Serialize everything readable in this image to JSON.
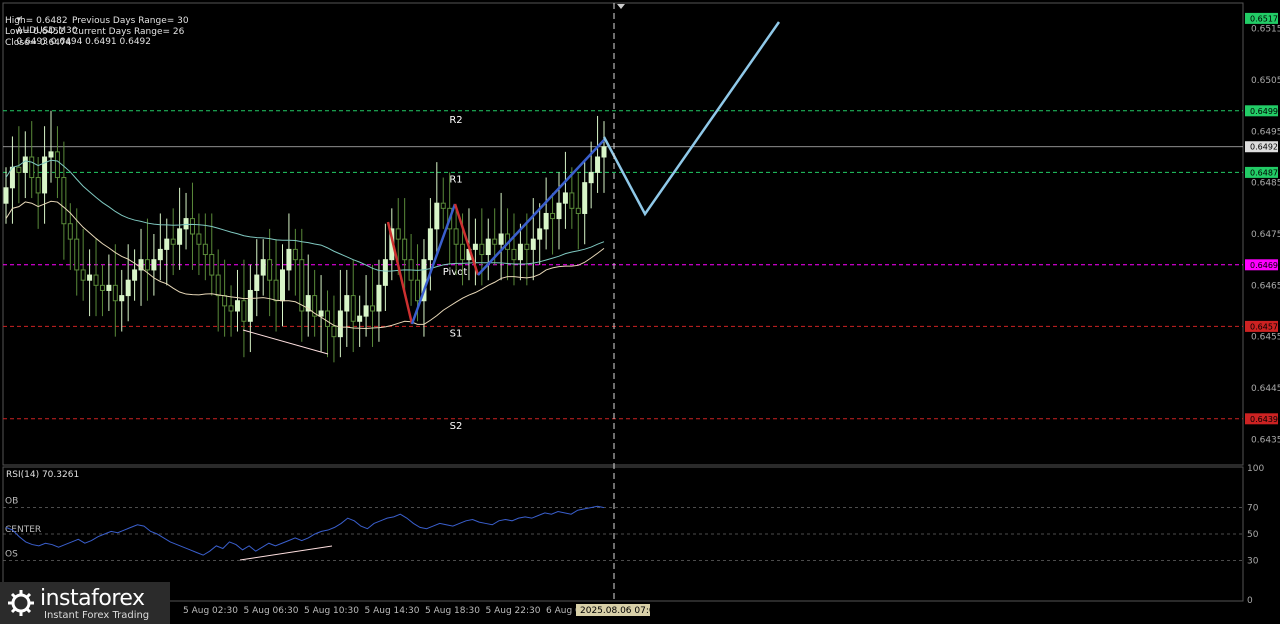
{
  "header": {
    "symbol": "AUDUSD,M30",
    "ohlc": "0.6493 0.6494 0.6491 0.6492",
    "high": "High= 0.6482",
    "prev_range": "Previous Days Range= 30",
    "low": "Low= 0.6452",
    "cur_range": "Current Days Range= 26",
    "close": "Close= 0.6474"
  },
  "colors": {
    "background": "#000000",
    "bull_candle": "#d8f5c8",
    "bear_candle": "#5a8a3a",
    "pivot_level": "#ff00ff",
    "support_level": "#cc2222",
    "resistance_level": "#22cc66",
    "forecast_line": "#8fc8e8",
    "zigzag_up": "#3a5fcd",
    "zigzag_down": "#cc3030",
    "rsi_line": "#3a5fcd"
  },
  "levels": [
    {
      "name": "R2",
      "price": 0.6499,
      "label": "0.6499",
      "color": "#22cc66"
    },
    {
      "name": "R1",
      "price": 0.6487,
      "label": "0.6487",
      "color": "#22cc66"
    },
    {
      "name": "Pivot",
      "price": 0.6469,
      "label": "0.6469",
      "color": "#ff00ff"
    },
    {
      "name": "S1",
      "price": 0.6457,
      "label": "0.6457",
      "color": "#cc2222"
    },
    {
      "name": "S2",
      "price": 0.6439,
      "label": "0.6439",
      "color": "#cc2222"
    }
  ],
  "price_axis": {
    "ticks": [
      "0.6515",
      "0.6505",
      "0.6495",
      "0.6485",
      "0.6475",
      "0.6465",
      "0.6455",
      "0.6445",
      "0.6435"
    ],
    "top_label": "0.6517",
    "current_label": "0.6492"
  },
  "time_axis": {
    "labels": [
      "5 Aug 02:30",
      "5 Aug 06:30",
      "5 Aug 10:30",
      "5 Aug 14:30",
      "5 Aug 18:30",
      "5 Aug 22:30",
      "6 Aug 0"
    ],
    "cursor_label": "2025.08.06 07:00"
  },
  "rsi": {
    "title": "RSI(14) 70.3261",
    "ticks": [
      "100",
      "70",
      "50",
      "30",
      "0"
    ],
    "zone_labels": [
      "OB",
      "CENTER",
      "OS"
    ]
  },
  "chart_data": {
    "type": "candlestick",
    "title": "AUDUSD,M30",
    "ylim": [
      0.643,
      0.652
    ],
    "candles_close_approx": [
      0.6484,
      0.6488,
      0.6487,
      0.649,
      0.6486,
      0.6483,
      0.649,
      0.6491,
      0.6486,
      0.6477,
      0.6474,
      0.6468,
      0.6466,
      0.6467,
      0.6465,
      0.6464,
      0.6465,
      0.6462,
      0.6463,
      0.6466,
      0.6468,
      0.647,
      0.6468,
      0.647,
      0.6472,
      0.6474,
      0.6473,
      0.6476,
      0.6478,
      0.6475,
      0.6473,
      0.6471,
      0.6467,
      0.6463,
      0.6461,
      0.646,
      0.6462,
      0.6458,
      0.6464,
      0.6467,
      0.647,
      0.6466,
      0.6462,
      0.6468,
      0.6472,
      0.647,
      0.646,
      0.6463,
      0.6459,
      0.646,
      0.6457,
      0.6455,
      0.646,
      0.6463,
      0.6458,
      0.6459,
      0.6461,
      0.646,
      0.6465,
      0.647,
      0.6476,
      0.6474,
      0.647,
      0.6466,
      0.6462,
      0.647,
      0.6476,
      0.6481,
      0.648,
      0.6476,
      0.6473,
      0.647,
      0.6472,
      0.6473,
      0.6471,
      0.6474,
      0.6473,
      0.6475,
      0.6472,
      0.647,
      0.6473,
      0.6472,
      0.6474,
      0.6476,
      0.6479,
      0.6478,
      0.6481,
      0.6483,
      0.648,
      0.6479,
      0.6485,
      0.6487,
      0.649,
      0.6492
    ],
    "forecast_path": [
      [
        0.6493
      ],
      [
        0.6482
      ],
      [
        0.6517
      ]
    ],
    "rsi_values": [
      55,
      53,
      48,
      44,
      42,
      41,
      43,
      42,
      40,
      42,
      44,
      46,
      43,
      45,
      48,
      50,
      52,
      51,
      53,
      55,
      57,
      56,
      52,
      50,
      47,
      44,
      42,
      40,
      38,
      36,
      34,
      37,
      41,
      39,
      44,
      42,
      38,
      41,
      37,
      40,
      43,
      41,
      43,
      45,
      47,
      45,
      47,
      50,
      52,
      53,
      55,
      58,
      62,
      60,
      56,
      54,
      58,
      60,
      62,
      63,
      65,
      62,
      58,
      55,
      54,
      56,
      58,
      57,
      56,
      58,
      60,
      61,
      59,
      58,
      57,
      60,
      61,
      60,
      62,
      63,
      62,
      64,
      66,
      65,
      67,
      66,
      65,
      68,
      69,
      70,
      71,
      70
    ]
  }
}
